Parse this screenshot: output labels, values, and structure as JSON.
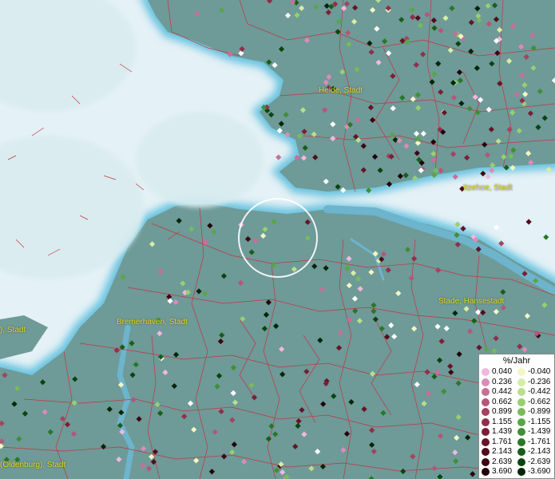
{
  "map": {
    "selection_circle": true
  },
  "cities": [
    {
      "id": "heide",
      "label": "Heide, Stadt"
    },
    {
      "id": "itzehoe",
      "label": "Itzehoe, Stadt"
    },
    {
      "id": "stade",
      "label": "Stade, Hansestadt"
    },
    {
      "id": "bremerhaven",
      "label": "Bremerhaven, Stadt"
    },
    {
      "id": "oldenburg",
      "label": "(Oldenburg), Stadt"
    },
    {
      "id": "left_edge",
      "label": "), Stadt"
    }
  ],
  "legend": {
    "title": "%/Jahr",
    "positive": [
      {
        "label": "0.040",
        "color": "#f2b7dd"
      },
      {
        "label": "0.236",
        "color": "#dc8bb8"
      },
      {
        "label": "0.442",
        "color": "#c86f98"
      },
      {
        "label": "0.662",
        "color": "#b55678"
      },
      {
        "label": "0.899",
        "color": "#a4435f"
      },
      {
        "label": "1.155",
        "color": "#8f2f4a"
      },
      {
        "label": "1.439",
        "color": "#7b1f36"
      },
      {
        "label": "1.761",
        "color": "#661427"
      },
      {
        "label": "2.143",
        "color": "#520c1b"
      },
      {
        "label": "2.639",
        "color": "#3d0612"
      },
      {
        "label": "3.690",
        "color": "#22020a"
      }
    ],
    "negative": [
      {
        "label": "-0.040",
        "color": "#f2f7c4"
      },
      {
        "label": "-0.236",
        "color": "#d6eda6"
      },
      {
        "label": "-0.442",
        "color": "#b8df8a"
      },
      {
        "label": "-0.662",
        "color": "#98cf70"
      },
      {
        "label": "-0.899",
        "color": "#78bb59"
      },
      {
        "label": "-1.155",
        "color": "#5aa646"
      },
      {
        "label": "-1.439",
        "color": "#3f8f35"
      },
      {
        "label": "-1.761",
        "color": "#2a7726"
      },
      {
        "label": "-2.143",
        "color": "#185e19"
      },
      {
        "label": "-2.639",
        "color": "#0a440e"
      },
      {
        "label": "-3.690",
        "color": "#022604"
      }
    ]
  },
  "colors": {
    "sea": "#e4f1f6",
    "land": "#6e9a98",
    "river": "#6db4cc",
    "borders": "#c0373f",
    "city_label": "#e8d619"
  }
}
